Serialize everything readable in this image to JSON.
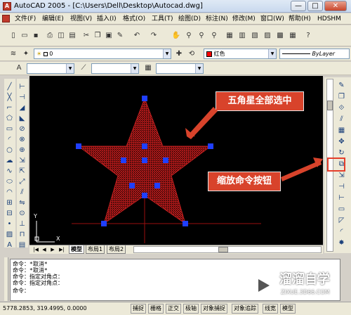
{
  "window": {
    "title": "AutoCAD 2005 - [C:\\Users\\Dell\\Desktop\\Autocad.dwg]",
    "app_icon_letter": "A",
    "controls": [
      "—",
      "□",
      "✕"
    ]
  },
  "menu": {
    "items": [
      "文件(F)",
      "编辑(E)",
      "视图(V)",
      "插入(I)",
      "格式(O)",
      "工具(T)",
      "绘图(D)",
      "标注(N)",
      "修改(M)",
      "窗口(W)",
      "帮助(H)",
      "HDSHM"
    ]
  },
  "layers": {
    "current_layer": "0",
    "color": "红色",
    "color_hex": "#ff0000",
    "linetype": "ByLayer"
  },
  "drawing": {
    "star_color": "#a81818",
    "grip_color": "#1f3fff",
    "ucs_y": "Y",
    "ucs_x": "X"
  },
  "tabs": {
    "nav_buttons": [
      "|◀",
      "◀",
      "▶",
      "▶|"
    ],
    "items": [
      "模型",
      "布局1",
      "布局2"
    ]
  },
  "command": {
    "lines": [
      "命令：*取消*",
      "命令：*取消*",
      "命令：指定对角点：",
      "命令：指定对角点："
    ],
    "prompt": "命令："
  },
  "status": {
    "coords": "5778.2853, 319.4995, 0.0000",
    "buttons": [
      "捕捉",
      "栅格",
      "正交",
      "极轴",
      "对象捕捉",
      "对象追踪",
      "线宽",
      "模型"
    ]
  },
  "annotations": {
    "star_note": "五角星全部选中",
    "zoom_note": "缩放命令按钮"
  },
  "watermark": {
    "brand": "溜溜自学",
    "url": "ZIXUE.3D66.COM"
  }
}
